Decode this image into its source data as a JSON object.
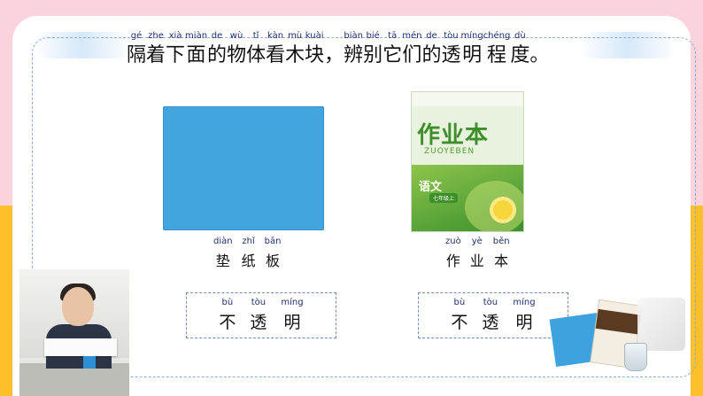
{
  "instruction": {
    "segments": [
      {
        "pinyin": "gé",
        "hanzi": "隔"
      },
      {
        "pinyin": "zhe",
        "hanzi": "着"
      },
      {
        "pinyin": "xià",
        "hanzi": "下"
      },
      {
        "pinyin": "miàn",
        "hanzi": "面"
      },
      {
        "pinyin": "de",
        "hanzi": "的"
      },
      {
        "pinyin": "wù",
        "hanzi": "物"
      },
      {
        "pinyin": "tǐ",
        "hanzi": "体"
      },
      {
        "pinyin": "kàn",
        "hanzi": "看"
      },
      {
        "pinyin": "mù",
        "hanzi": "木"
      },
      {
        "pinyin": "kuài",
        "hanzi": "块"
      },
      {
        "pinyin": "",
        "hanzi": "，"
      },
      {
        "pinyin": "biàn",
        "hanzi": "辨"
      },
      {
        "pinyin": "bié",
        "hanzi": "别"
      },
      {
        "pinyin": "tā",
        "hanzi": "它"
      },
      {
        "pinyin": "mén",
        "hanzi": "们"
      },
      {
        "pinyin": "de",
        "hanzi": "的"
      },
      {
        "pinyin": "tòu",
        "hanzi": "透"
      },
      {
        "pinyin": "míng",
        "hanzi": "明"
      },
      {
        "pinyin": "chéng",
        "hanzi": "程"
      },
      {
        "pinyin": "dù",
        "hanzi": "度"
      },
      {
        "pinyin": "",
        "hanzi": "。"
      }
    ]
  },
  "items": [
    {
      "name_pinyin": [
        "diàn",
        "zhǐ",
        "bǎn"
      ],
      "name_hanzi": [
        "垫",
        "纸",
        "板"
      ],
      "result_pinyin": [
        "bù",
        "tòu",
        "míng"
      ],
      "result_hanzi": [
        "不",
        "透",
        "明"
      ]
    },
    {
      "name_pinyin": [
        "zuò",
        "yè",
        "běn"
      ],
      "name_hanzi": [
        "作",
        "业",
        "本"
      ],
      "result_pinyin": [
        "bù",
        "tòu",
        "míng"
      ],
      "result_hanzi": [
        "不",
        "透",
        "明"
      ]
    }
  ],
  "book_cover": {
    "title": "作业本",
    "subtitle": "ZUOYEBEN",
    "subject": "语文",
    "grade": "七年级上"
  },
  "colors": {
    "pink_band": "#fbd3dc",
    "yellow_band": "#fdbf2a",
    "pad_blue": "#43a4de",
    "pinyin_text": "#1f2f6e",
    "dashed_border": "#6f8fbf"
  }
}
